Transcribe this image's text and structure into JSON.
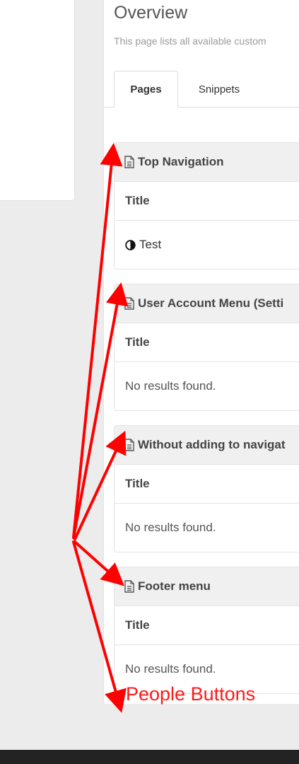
{
  "page": {
    "title": "Overview",
    "description": "This page lists all available custom"
  },
  "tabs": [
    {
      "label": "Pages",
      "active": true
    },
    {
      "label": "Snippets",
      "active": false
    }
  ],
  "cards": [
    {
      "header": "Top Navigation",
      "column": "Title",
      "row": "Test",
      "row_icon": "half-circle-icon"
    },
    {
      "header": "User Account Menu (Setti",
      "column": "Title",
      "row": "No results found."
    },
    {
      "header": "Without adding to navigat",
      "column": "Title",
      "row": "No results found."
    },
    {
      "header": "Footer menu",
      "column": "Title",
      "row": "No results found."
    }
  ],
  "annotation": {
    "label": "People Buttons",
    "color": "#ff0000"
  },
  "icons": {
    "card_header": "document-icon"
  }
}
